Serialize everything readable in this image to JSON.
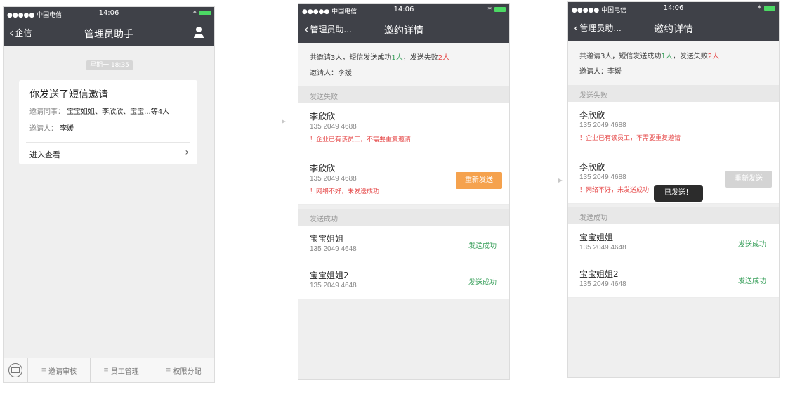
{
  "status": {
    "carrier": "●●●●● 中国电信",
    "time": "14:06"
  },
  "screen1": {
    "nav": {
      "back_label": "企信",
      "title": "管理员助手"
    },
    "date_chip": "星期一 18:35",
    "card": {
      "title": "你发送了短信邀请",
      "colleagues_label": "邀请同事：",
      "colleagues_value": "宝宝姐姐、李欣欣、宝宝...等4人",
      "inviter_label": "邀请人：",
      "inviter_value": "李媛",
      "enter_label": "进入查看"
    },
    "tabs": [
      "邀请审核",
      "员工管理",
      "权限分配"
    ]
  },
  "detail": {
    "back_label": "管理员助...",
    "title": "邀约详情",
    "summary_a": "共邀请3人，短信发送成功",
    "success_count": "1人",
    "summary_b": "，发送失败",
    "fail_count": "2人",
    "inviter_line": "邀请人：李媛",
    "failed_header": "发送失败",
    "success_header": "发送成功",
    "failed": [
      {
        "name": "李欣欣",
        "phone": "135 2049 4688",
        "reason": "！企业已有该员工，不需要重复邀请"
      },
      {
        "name": "李欣欣",
        "phone": "135 2049 4688",
        "reason": "！网络不好，未发送成功"
      }
    ],
    "succeeded": [
      {
        "name": "宝宝姐姐",
        "phone": "135 2049 4648",
        "status": "发送成功"
      },
      {
        "name": "宝宝姐姐2",
        "phone": "135 2049 4648",
        "status": "发送成功"
      }
    ],
    "resend_label": "重新发送",
    "toast": "已发送！"
  },
  "colors": {
    "navbar": "#3f4148",
    "success": "#3aa05c",
    "fail": "#e64a4a",
    "resend": "#f5a24e"
  }
}
